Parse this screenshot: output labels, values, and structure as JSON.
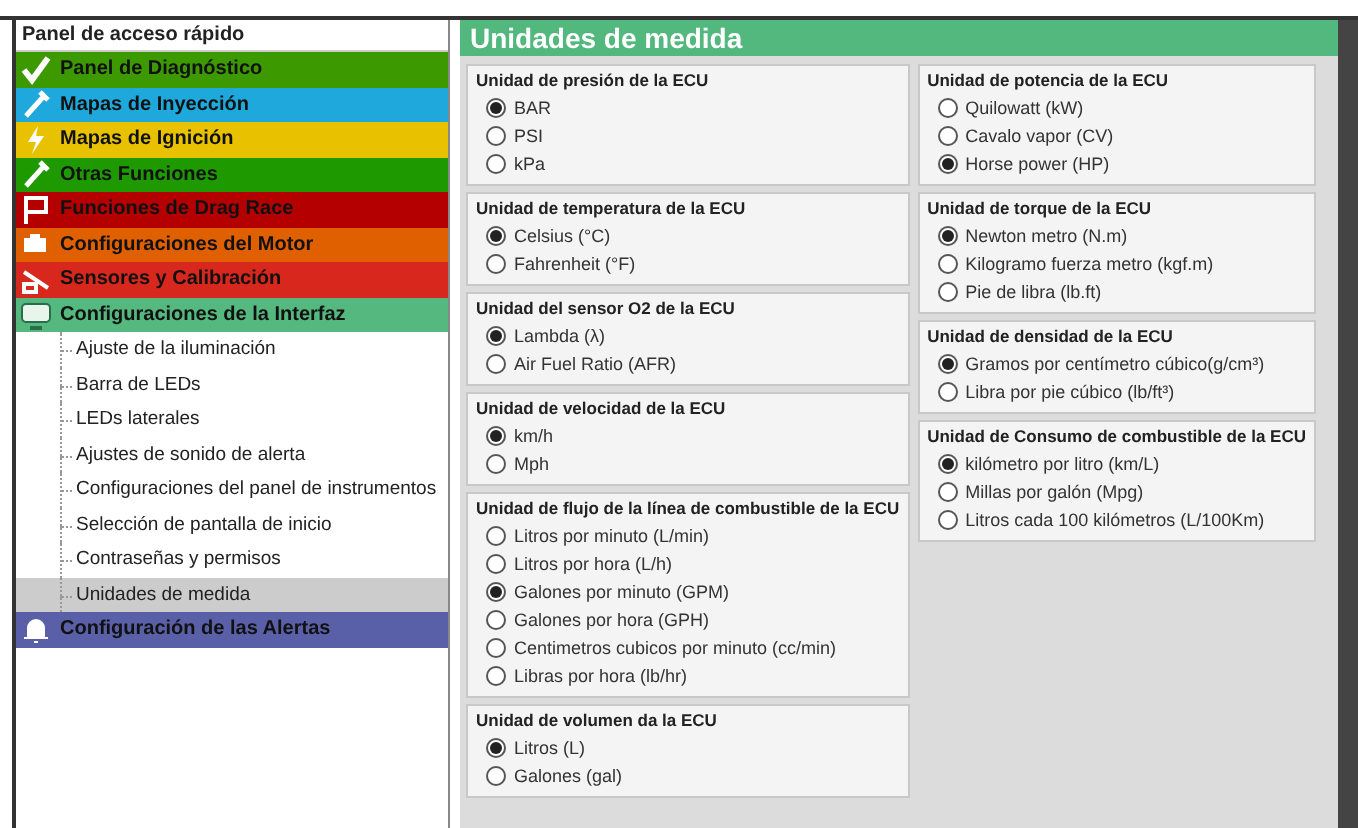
{
  "sidebar": {
    "title": "Panel de acceso rápido",
    "items": [
      {
        "label": "Panel de Diagnóstico",
        "color": "#3c9a00"
      },
      {
        "label": "Mapas de Inyección",
        "color": "#1ea8dc"
      },
      {
        "label": "Mapas de Ignición",
        "color": "#e8c200"
      },
      {
        "label": "Otras Funciones",
        "color": "#1e9a00"
      },
      {
        "label": "Funciones de Drag Race",
        "color": "#b40000"
      },
      {
        "label": "Configuraciones del Motor",
        "color": "#e06000"
      },
      {
        "label": "Sensores y Calibración",
        "color": "#d8281e"
      },
      {
        "label": "Configuraciones de la Interfaz",
        "color": "#55b87e",
        "children": [
          {
            "label": "Ajuste de la iluminación",
            "selected": false
          },
          {
            "label": "Barra de LEDs",
            "selected": false
          },
          {
            "label": "LEDs laterales",
            "selected": false
          },
          {
            "label": "Ajustes de sonido de alerta",
            "selected": false
          },
          {
            "label": "Configuraciones del panel de instrumentos",
            "selected": false
          },
          {
            "label": "Selección de pantalla de inicio",
            "selected": false
          },
          {
            "label": "Contraseñas y permisos",
            "selected": false
          },
          {
            "label": "Unidades de medida",
            "selected": true
          }
        ]
      },
      {
        "label": "Configuración de las Alertas",
        "color": "#5a60a8"
      }
    ]
  },
  "panel": {
    "title": "Unidades de medida",
    "columns": [
      [
        {
          "title": "Unidad de presión de la ECU",
          "options": [
            {
              "label": "BAR",
              "selected": true
            },
            {
              "label": "PSI",
              "selected": false
            },
            {
              "label": "kPa",
              "selected": false
            }
          ]
        },
        {
          "title": "Unidad de temperatura de la ECU",
          "options": [
            {
              "label": "Celsius (°C)",
              "selected": true
            },
            {
              "label": "Fahrenheit (°F)",
              "selected": false
            }
          ]
        },
        {
          "title": "Unidad del sensor O2 de la ECU",
          "options": [
            {
              "label": "Lambda (λ)",
              "selected": true
            },
            {
              "label": "Air Fuel Ratio (AFR)",
              "selected": false
            }
          ]
        },
        {
          "title": "Unidad de velocidad de la ECU",
          "options": [
            {
              "label": "km/h",
              "selected": true
            },
            {
              "label": "Mph",
              "selected": false
            }
          ]
        },
        {
          "title": "Unidad de flujo de la línea de combustible de la ECU",
          "options": [
            {
              "label": "Litros por minuto (L/min)",
              "selected": false
            },
            {
              "label": "Litros por hora (L/h)",
              "selected": false
            },
            {
              "label": "Galones por minuto (GPM)",
              "selected": true
            },
            {
              "label": "Galones por hora (GPH)",
              "selected": false
            },
            {
              "label": "Centimetros cubicos por minuto (cc/min)",
              "selected": false
            },
            {
              "label": "Libras por hora (lb/hr)",
              "selected": false
            }
          ]
        },
        {
          "title": "Unidad de volumen da la  ECU",
          "options": [
            {
              "label": "Litros (L)",
              "selected": true
            },
            {
              "label": "Galones (gal)",
              "selected": false
            }
          ]
        }
      ],
      [
        {
          "title": "Unidad de potencia de la ECU",
          "options": [
            {
              "label": "Quilowatt (kW)",
              "selected": false
            },
            {
              "label": "Cavalo vapor (CV)",
              "selected": false
            },
            {
              "label": "Horse power (HP)",
              "selected": true
            }
          ]
        },
        {
          "title": "Unidad de torque de la ECU",
          "options": [
            {
              "label": "Newton metro (N.m)",
              "selected": true
            },
            {
              "label": "Kilogramo fuerza metro (kgf.m)",
              "selected": false
            },
            {
              "label": "Pie de libra (lb.ft)",
              "selected": false
            }
          ]
        },
        {
          "title": "Unidad de densidad de la ECU",
          "options": [
            {
              "label": "Gramos por centímetro cúbico(g/cm³)",
              "selected": true
            },
            {
              "label": "Libra por pie cúbico (lb/ft³)",
              "selected": false
            }
          ]
        },
        {
          "title": "Unidad de Consumo de combustible de la ECU",
          "options": [
            {
              "label": "kilómetro por litro (km/L)",
              "selected": true
            },
            {
              "label": "Millas por galón (Mpg)",
              "selected": false
            },
            {
              "label": "Litros cada 100 kilómetros (L/100Km)",
              "selected": false
            }
          ]
        }
      ]
    ]
  }
}
